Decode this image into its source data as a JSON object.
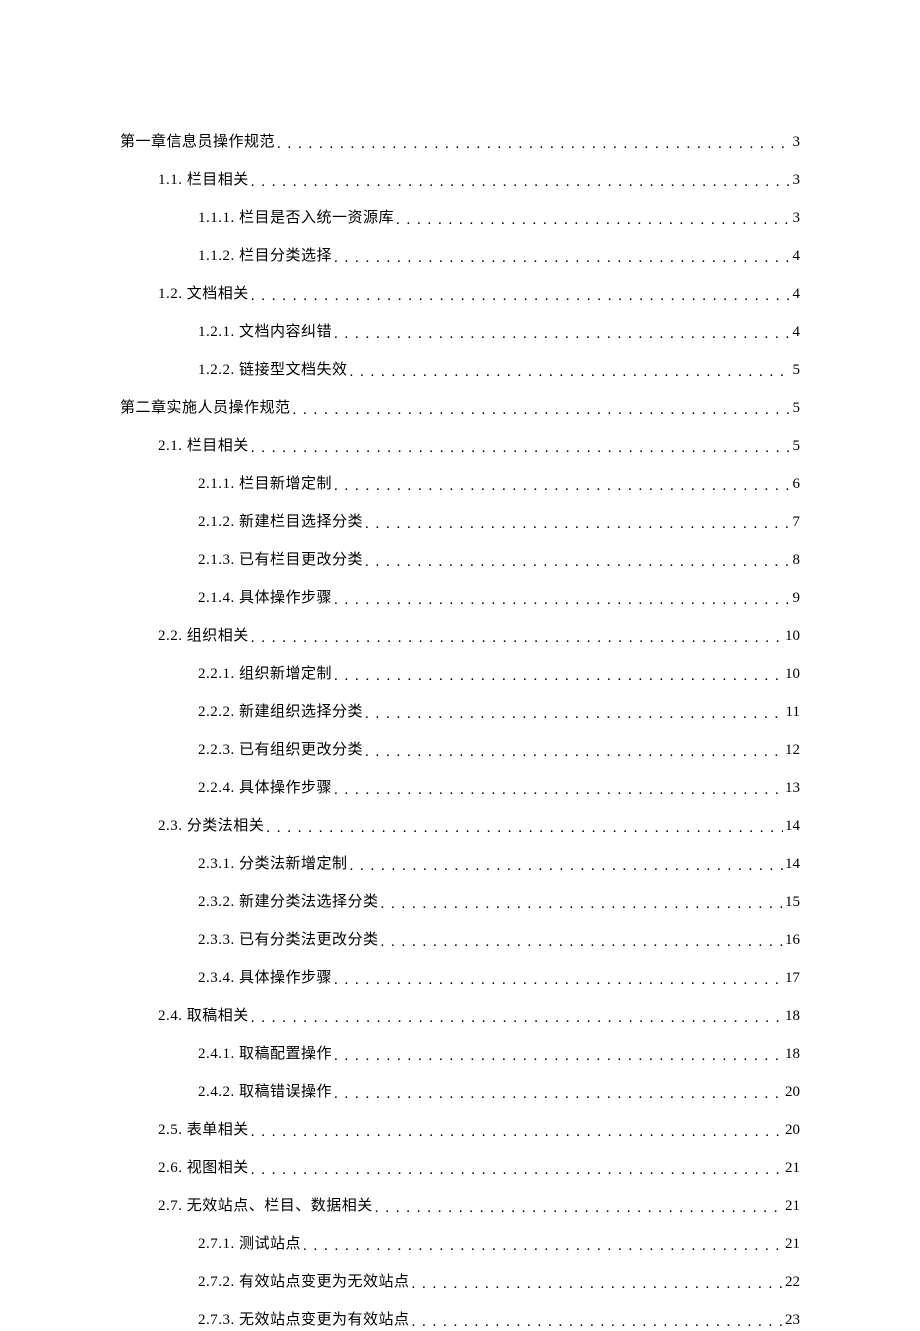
{
  "toc": [
    {
      "level": 1,
      "number": "",
      "title": "第一章信息员操作规范",
      "page": "3"
    },
    {
      "level": 2,
      "number": "1.1.",
      "title": "栏目相关",
      "page": "3"
    },
    {
      "level": 3,
      "number": "1.1.1.",
      "title": "栏目是否入统一资源库",
      "page": "3"
    },
    {
      "level": 3,
      "number": "1.1.2.",
      "title": "栏目分类选择",
      "page": "4"
    },
    {
      "level": 2,
      "number": "1.2.",
      "title": "文档相关",
      "page": "4"
    },
    {
      "level": 3,
      "number": "1.2.1.",
      "title": "文档内容纠错",
      "page": "4"
    },
    {
      "level": 3,
      "number": "1.2.2.",
      "title": "链接型文档失效",
      "page": "5"
    },
    {
      "level": 1,
      "number": "",
      "title": "第二章实施人员操作规范",
      "page": "5"
    },
    {
      "level": 2,
      "number": "2.1.",
      "title": "栏目相关",
      "page": "5"
    },
    {
      "level": 3,
      "number": "2.1.1.",
      "title": "栏目新增定制",
      "page": "6"
    },
    {
      "level": 3,
      "number": "2.1.2.",
      "title": "新建栏目选择分类",
      "page": "7"
    },
    {
      "level": 3,
      "number": "2.1.3.",
      "title": "已有栏目更改分类",
      "page": "8"
    },
    {
      "level": 3,
      "number": "2.1.4.",
      "title": "具体操作步骤",
      "page": "9"
    },
    {
      "level": 2,
      "number": "2.2.",
      "title": "组织相关",
      "page": "10"
    },
    {
      "level": 3,
      "number": "2.2.1.",
      "title": "组织新增定制",
      "page": "10"
    },
    {
      "level": 3,
      "number": "2.2.2.",
      "title": "新建组织选择分类",
      "page": "11"
    },
    {
      "level": 3,
      "number": "2.2.3.",
      "title": "已有组织更改分类",
      "page": "12"
    },
    {
      "level": 3,
      "number": "2.2.4.",
      "title": "具体操作步骤",
      "page": "13"
    },
    {
      "level": 2,
      "number": "2.3.",
      "title": "分类法相关",
      "page": "14"
    },
    {
      "level": 3,
      "number": "2.3.1.",
      "title": "分类法新增定制",
      "page": "14"
    },
    {
      "level": 3,
      "number": "2.3.2.",
      "title": "新建分类法选择分类",
      "page": "15"
    },
    {
      "level": 3,
      "number": "2.3.3.",
      "title": "已有分类法更改分类",
      "page": "16"
    },
    {
      "level": 3,
      "number": "2.3.4.",
      "title": "具体操作步骤",
      "page": "17"
    },
    {
      "level": 2,
      "number": "2.4.",
      "title": "取稿相关",
      "page": "18"
    },
    {
      "level": 3,
      "number": "2.4.1.",
      "title": "取稿配置操作",
      "page": "18"
    },
    {
      "level": 3,
      "number": "2.4.2.",
      "title": "取稿错误操作",
      "page": "20"
    },
    {
      "level": 2,
      "number": "2.5.",
      "title": "表单相关",
      "page": "20"
    },
    {
      "level": 2,
      "number": "2.6.",
      "title": "视图相关",
      "page": "21"
    },
    {
      "level": 2,
      "number": "2.7.",
      "title": "无效站点、栏目、数据相关",
      "page": "21"
    },
    {
      "level": 3,
      "number": "2.7.1.",
      "title": "测试站点",
      "page": "21"
    },
    {
      "level": 3,
      "number": "2.7.2.",
      "title": "有效站点变更为无效站点",
      "page": "22"
    },
    {
      "level": 3,
      "number": "2.7.3.",
      "title": "无效站点变更为有效站点",
      "page": "23"
    }
  ]
}
